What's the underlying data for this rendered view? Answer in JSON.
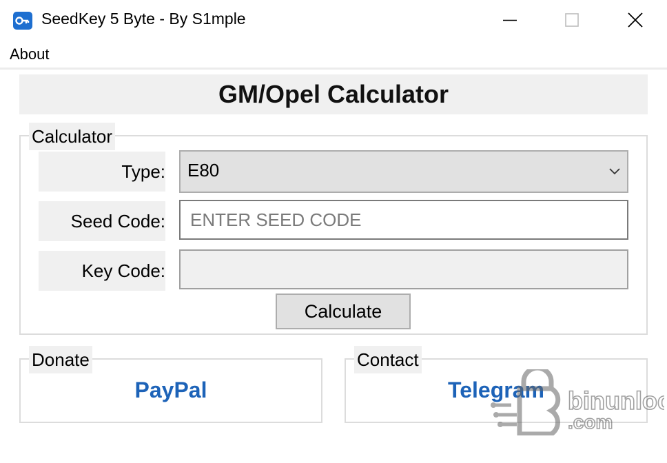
{
  "window": {
    "title": "SeedKey 5 Byte - By S1mple",
    "icon": "key-icon",
    "controls": [
      "minimize-icon",
      "maximize-icon",
      "close-icon"
    ]
  },
  "menu": {
    "items": [
      {
        "label": "About"
      }
    ]
  },
  "heading": "GM/Opel Calculator",
  "calculator": {
    "group_label": "Calculator",
    "type_label": "Type:",
    "type_value": "E80",
    "seed_label": "Seed Code:",
    "seed_placeholder": "ENTER SEED CODE",
    "seed_value": "",
    "key_label": "Key Code:",
    "key_value": "",
    "calculate_label": "Calculate"
  },
  "donate": {
    "group_label": "Donate",
    "link_label": "PayPal"
  },
  "contact": {
    "group_label": "Contact",
    "link_label": "Telegram"
  },
  "watermark": {
    "text_main": "binunlock",
    "text_domain": ".com"
  },
  "colors": {
    "link": "#1d63b8",
    "panel": "#f0f0f0",
    "button": "#e1e1e1"
  }
}
